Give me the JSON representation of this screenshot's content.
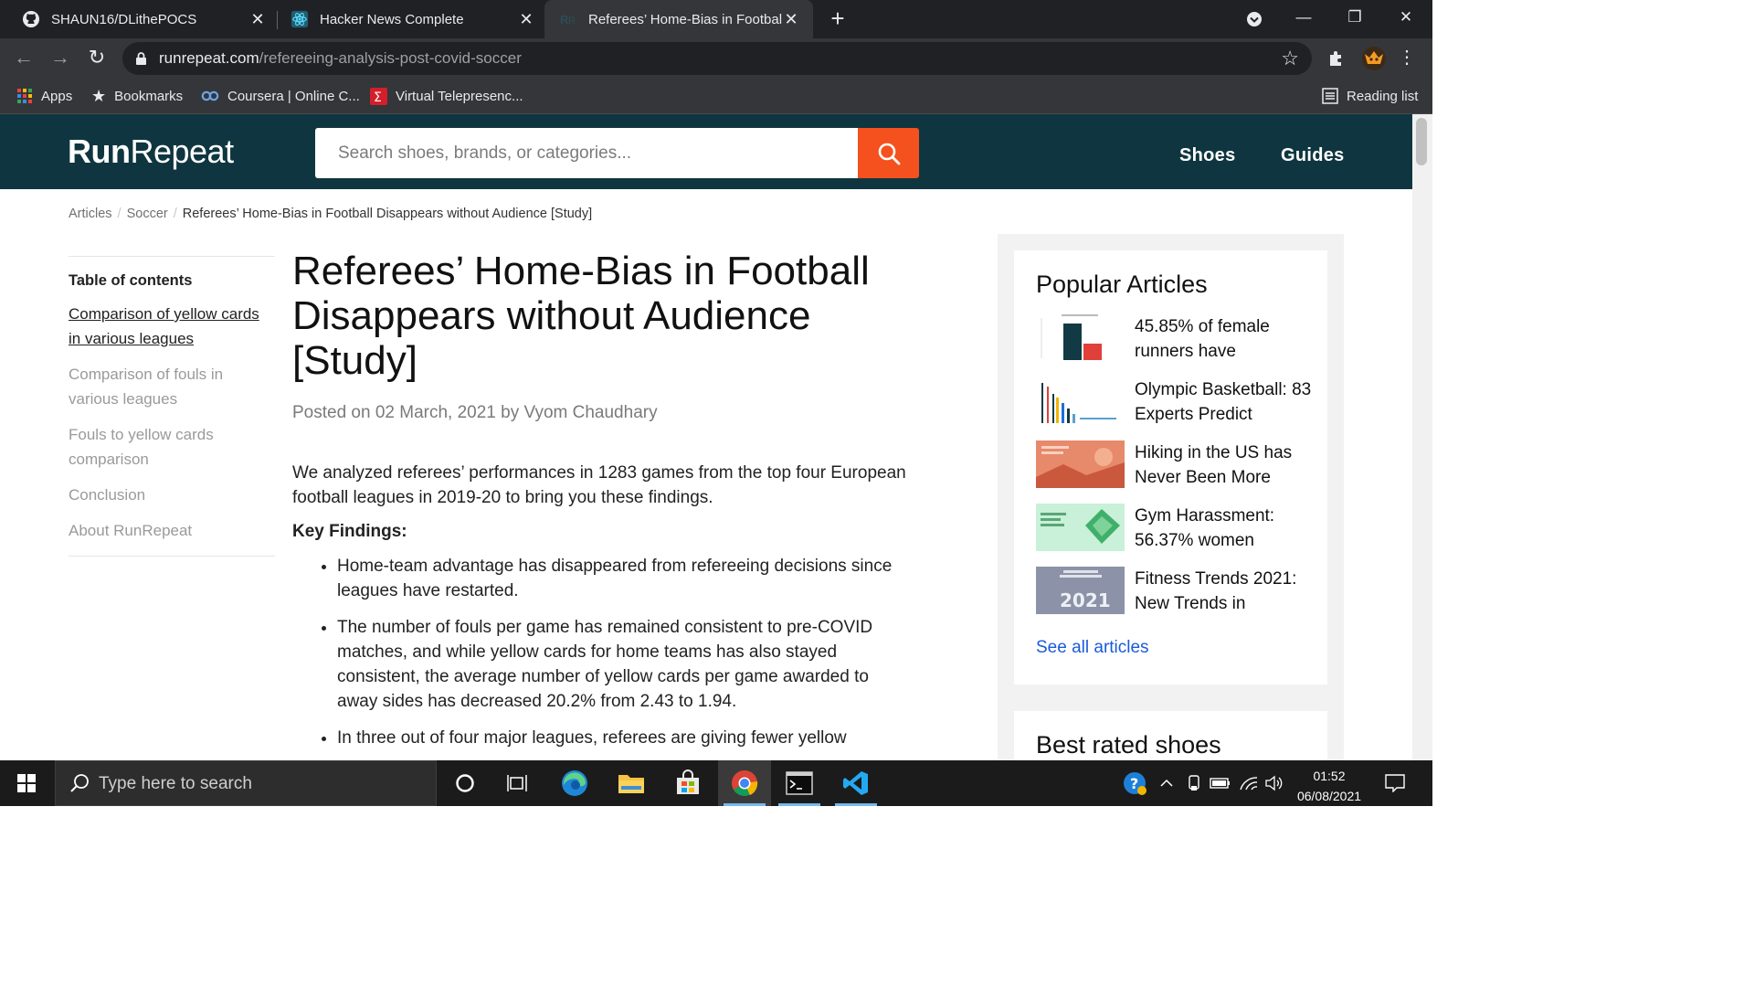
{
  "browser": {
    "tabs": [
      {
        "title": "SHAUN16/DLithePOCS",
        "icon": "github-icon"
      },
      {
        "title": "Hacker News Complete",
        "icon": "react-icon"
      },
      {
        "title": "Referees’ Home-Bias in Football",
        "icon": "runrepeat-icon"
      }
    ],
    "url_domain": "runrepeat.com",
    "url_path": "/refereeing-analysis-post-covid-soccer",
    "bookmarks": [
      {
        "label": "Apps",
        "icon": "apps-grid-icon"
      },
      {
        "label": "Bookmarks",
        "icon": "star-icon"
      },
      {
        "label": "Coursera | Online C...",
        "icon": "coursera-icon"
      },
      {
        "label": "Virtual Telepresenc...",
        "icon": "sigma-icon"
      }
    ],
    "reading_list": "Reading list"
  },
  "site": {
    "logo_bold": "Run",
    "logo_light": "Repeat",
    "search_placeholder": "Search shoes, brands, or categories...",
    "nav": [
      "Shoes",
      "Guides"
    ],
    "accent_color": "#f4511e",
    "header_color": "#0f3640"
  },
  "breadcrumb": {
    "items": [
      "Articles",
      "Soccer"
    ],
    "current": "Referees’ Home-Bias in Football Disappears without Audience [Study]"
  },
  "toc": {
    "heading": "Table of contents",
    "items": [
      "Comparison of yellow cards in various leagues",
      "Comparison of fouls in various leagues",
      "Fouls to yellow cards comparison",
      "Conclusion",
      "About RunRepeat"
    ]
  },
  "article": {
    "title": "Referees’ Home-Bias in Football Disappears without Audience [Study]",
    "meta": "Posted on 02 March, 2021 by Vyom Chaudhary",
    "intro": "We analyzed referees’ performances in 1283 games from the top four European football leagues in 2019-20 to bring you these findings.",
    "key_findings_label": "Key Findings:",
    "findings": [
      "Home-team advantage has disappeared from refereeing decisions since leagues have restarted.",
      "The number of fouls per game has remained consistent to pre-COVID matches, and while yellow cards for home teams has also stayed consistent, the average number of yellow cards per game awarded to away sides has decreased 20.2% from 2.43 to 1.94.",
      "In three out of four major leagues, referees are giving fewer yellow"
    ]
  },
  "sidebar": {
    "popular_heading": "Popular Articles",
    "popular": [
      {
        "title": "45.85% of female runners have",
        "thumb": "bar-chart-thumb"
      },
      {
        "title": "Olympic Basketball: 83 Experts Predict",
        "thumb": "multibar-chart-thumb"
      },
      {
        "title": "Hiking in the US has Never Been More",
        "thumb": "hiking-thumb"
      },
      {
        "title": "Gym Harassment: 56.37% women",
        "thumb": "gym-thumb"
      },
      {
        "title": "Fitness Trends 2021: New Trends in",
        "thumb": "fitness-thumb"
      }
    ],
    "see_all": "See all articles",
    "best_rated_heading": "Best rated shoes"
  },
  "taskbar": {
    "search_placeholder": "Type here to search",
    "time": "01:52",
    "date": "06/08/2021"
  }
}
